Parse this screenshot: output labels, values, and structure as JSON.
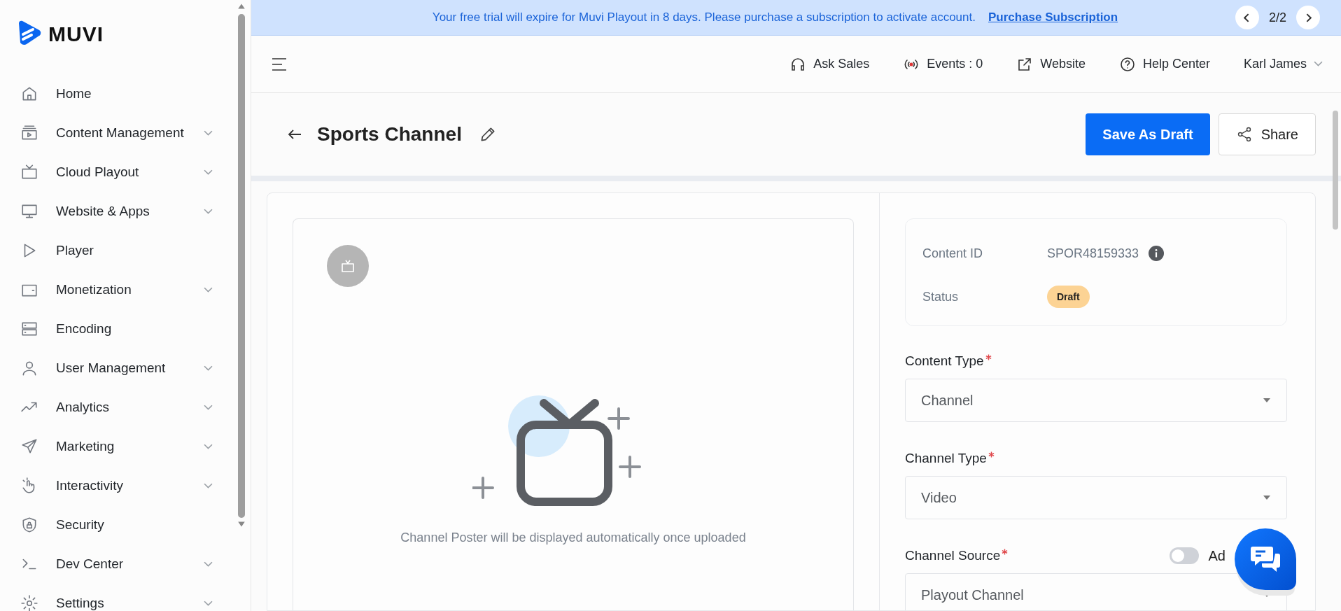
{
  "banner": {
    "message": "Your free trial will expire for Muvi Playout in 8 days. Please purchase a subscription to activate account.",
    "link": "Purchase Subscription",
    "pager": "2/2"
  },
  "topbar": {
    "links": [
      {
        "label": "Ask Sales"
      },
      {
        "label": "Events : 0"
      },
      {
        "label": "Website"
      },
      {
        "label": "Help Center"
      }
    ],
    "user": "Karl James"
  },
  "sidebar": {
    "brand": "MUVI",
    "items": [
      {
        "label": "Home",
        "has_submenu": false
      },
      {
        "label": "Content Management",
        "has_submenu": true
      },
      {
        "label": "Cloud Playout",
        "has_submenu": true
      },
      {
        "label": "Website & Apps",
        "has_submenu": true
      },
      {
        "label": "Player",
        "has_submenu": false
      },
      {
        "label": "Monetization",
        "has_submenu": true
      },
      {
        "label": "Encoding",
        "has_submenu": false
      },
      {
        "label": "User Management",
        "has_submenu": true
      },
      {
        "label": "Analytics",
        "has_submenu": true
      },
      {
        "label": "Marketing",
        "has_submenu": true
      },
      {
        "label": "Interactivity",
        "has_submenu": true
      },
      {
        "label": "Security",
        "has_submenu": false
      },
      {
        "label": "Dev Center",
        "has_submenu": true
      },
      {
        "label": "Settings",
        "has_submenu": true
      }
    ]
  },
  "header": {
    "title": "Sports Channel",
    "primary_button": "Save As Draft",
    "share_button": "Share"
  },
  "poster": {
    "caption": "Channel Poster will be displayed automatically once uploaded"
  },
  "details": {
    "rows": [
      {
        "label": "Content ID",
        "value": "SPOR48159333",
        "kind": "id"
      },
      {
        "label": "Status",
        "value": "Draft",
        "kind": "badge"
      }
    ]
  },
  "form": {
    "fields": [
      {
        "label": "Content Type",
        "required": true,
        "value": "Channel"
      },
      {
        "label": "Channel Type",
        "required": true,
        "value": "Video"
      },
      {
        "label": "Channel Source",
        "required": true,
        "value": "Playout Channel",
        "toggle": {
          "label": "Ad",
          "on": false
        }
      }
    ]
  }
}
